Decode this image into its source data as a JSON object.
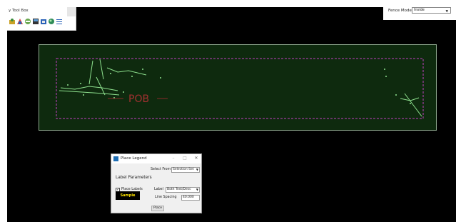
{
  "toolbox": {
    "title": "y Tool Box",
    "icons": [
      "tool-icon-1",
      "tool-icon-2",
      "tool-icon-3",
      "tool-icon-4",
      "tool-icon-5",
      "tool-icon-6",
      "tool-icon-7"
    ]
  },
  "fence": {
    "label": "Fence Mode",
    "value": "Inside"
  },
  "drawing": {
    "label": "POB"
  },
  "dialog": {
    "title": "Place Legend",
    "select_from_label": "Select From",
    "select_from_value": "Selection Set",
    "section_label": "Label Parameters",
    "place_labels_label": "Place Labels",
    "place_labels_checked": "✓",
    "label_label": "Label",
    "label_value": "Both Text/Desc",
    "line_spacing_label": "Line Spacing",
    "line_spacing_value": "40.000",
    "sample_text": "Sample",
    "place_button": "Place"
  },
  "colors": {
    "canvas": "#000000",
    "sheet": "#0e2a0e",
    "fence_line": "#c040c0",
    "elements": "#8fe28f",
    "sample_text": "#ffe400"
  }
}
